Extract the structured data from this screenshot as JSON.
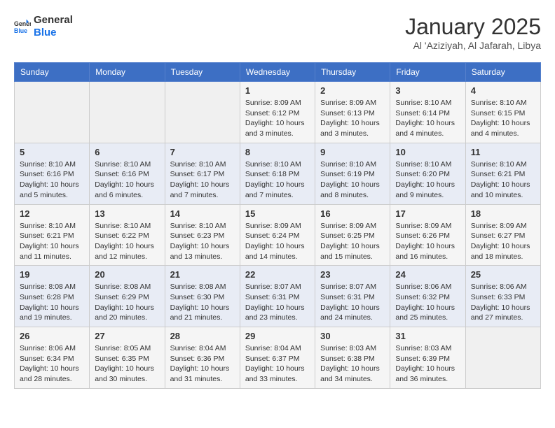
{
  "header": {
    "logo_line1": "General",
    "logo_line2": "Blue",
    "month": "January 2025",
    "location": "Al 'Aziziyah, Al Jafarah, Libya"
  },
  "weekdays": [
    "Sunday",
    "Monday",
    "Tuesday",
    "Wednesday",
    "Thursday",
    "Friday",
    "Saturday"
  ],
  "weeks": [
    [
      {
        "day": "",
        "info": ""
      },
      {
        "day": "",
        "info": ""
      },
      {
        "day": "",
        "info": ""
      },
      {
        "day": "1",
        "info": "Sunrise: 8:09 AM\nSunset: 6:12 PM\nDaylight: 10 hours\nand 3 minutes."
      },
      {
        "day": "2",
        "info": "Sunrise: 8:09 AM\nSunset: 6:13 PM\nDaylight: 10 hours\nand 3 minutes."
      },
      {
        "day": "3",
        "info": "Sunrise: 8:10 AM\nSunset: 6:14 PM\nDaylight: 10 hours\nand 4 minutes."
      },
      {
        "day": "4",
        "info": "Sunrise: 8:10 AM\nSunset: 6:15 PM\nDaylight: 10 hours\nand 4 minutes."
      }
    ],
    [
      {
        "day": "5",
        "info": "Sunrise: 8:10 AM\nSunset: 6:16 PM\nDaylight: 10 hours\nand 5 minutes."
      },
      {
        "day": "6",
        "info": "Sunrise: 8:10 AM\nSunset: 6:16 PM\nDaylight: 10 hours\nand 6 minutes."
      },
      {
        "day": "7",
        "info": "Sunrise: 8:10 AM\nSunset: 6:17 PM\nDaylight: 10 hours\nand 7 minutes."
      },
      {
        "day": "8",
        "info": "Sunrise: 8:10 AM\nSunset: 6:18 PM\nDaylight: 10 hours\nand 7 minutes."
      },
      {
        "day": "9",
        "info": "Sunrise: 8:10 AM\nSunset: 6:19 PM\nDaylight: 10 hours\nand 8 minutes."
      },
      {
        "day": "10",
        "info": "Sunrise: 8:10 AM\nSunset: 6:20 PM\nDaylight: 10 hours\nand 9 minutes."
      },
      {
        "day": "11",
        "info": "Sunrise: 8:10 AM\nSunset: 6:21 PM\nDaylight: 10 hours\nand 10 minutes."
      }
    ],
    [
      {
        "day": "12",
        "info": "Sunrise: 8:10 AM\nSunset: 6:21 PM\nDaylight: 10 hours\nand 11 minutes."
      },
      {
        "day": "13",
        "info": "Sunrise: 8:10 AM\nSunset: 6:22 PM\nDaylight: 10 hours\nand 12 minutes."
      },
      {
        "day": "14",
        "info": "Sunrise: 8:10 AM\nSunset: 6:23 PM\nDaylight: 10 hours\nand 13 minutes."
      },
      {
        "day": "15",
        "info": "Sunrise: 8:09 AM\nSunset: 6:24 PM\nDaylight: 10 hours\nand 14 minutes."
      },
      {
        "day": "16",
        "info": "Sunrise: 8:09 AM\nSunset: 6:25 PM\nDaylight: 10 hours\nand 15 minutes."
      },
      {
        "day": "17",
        "info": "Sunrise: 8:09 AM\nSunset: 6:26 PM\nDaylight: 10 hours\nand 16 minutes."
      },
      {
        "day": "18",
        "info": "Sunrise: 8:09 AM\nSunset: 6:27 PM\nDaylight: 10 hours\nand 18 minutes."
      }
    ],
    [
      {
        "day": "19",
        "info": "Sunrise: 8:08 AM\nSunset: 6:28 PM\nDaylight: 10 hours\nand 19 minutes."
      },
      {
        "day": "20",
        "info": "Sunrise: 8:08 AM\nSunset: 6:29 PM\nDaylight: 10 hours\nand 20 minutes."
      },
      {
        "day": "21",
        "info": "Sunrise: 8:08 AM\nSunset: 6:30 PM\nDaylight: 10 hours\nand 21 minutes."
      },
      {
        "day": "22",
        "info": "Sunrise: 8:07 AM\nSunset: 6:31 PM\nDaylight: 10 hours\nand 23 minutes."
      },
      {
        "day": "23",
        "info": "Sunrise: 8:07 AM\nSunset: 6:31 PM\nDaylight: 10 hours\nand 24 minutes."
      },
      {
        "day": "24",
        "info": "Sunrise: 8:06 AM\nSunset: 6:32 PM\nDaylight: 10 hours\nand 25 minutes."
      },
      {
        "day": "25",
        "info": "Sunrise: 8:06 AM\nSunset: 6:33 PM\nDaylight: 10 hours\nand 27 minutes."
      }
    ],
    [
      {
        "day": "26",
        "info": "Sunrise: 8:06 AM\nSunset: 6:34 PM\nDaylight: 10 hours\nand 28 minutes."
      },
      {
        "day": "27",
        "info": "Sunrise: 8:05 AM\nSunset: 6:35 PM\nDaylight: 10 hours\nand 30 minutes."
      },
      {
        "day": "28",
        "info": "Sunrise: 8:04 AM\nSunset: 6:36 PM\nDaylight: 10 hours\nand 31 minutes."
      },
      {
        "day": "29",
        "info": "Sunrise: 8:04 AM\nSunset: 6:37 PM\nDaylight: 10 hours\nand 33 minutes."
      },
      {
        "day": "30",
        "info": "Sunrise: 8:03 AM\nSunset: 6:38 PM\nDaylight: 10 hours\nand 34 minutes."
      },
      {
        "day": "31",
        "info": "Sunrise: 8:03 AM\nSunset: 6:39 PM\nDaylight: 10 hours\nand 36 minutes."
      },
      {
        "day": "",
        "info": ""
      }
    ]
  ]
}
